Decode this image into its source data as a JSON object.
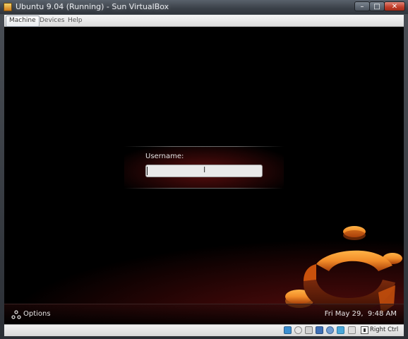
{
  "window": {
    "title": "Ubuntu 9.04 (Running) - Sun VirtualBox",
    "minimize_glyph": "–",
    "maximize_glyph": "□",
    "close_glyph": "✕"
  },
  "menubar": {
    "items": [
      {
        "label": "Machine",
        "active": true
      },
      {
        "label": "Devices",
        "active": false
      },
      {
        "label": "Help",
        "active": false
      }
    ]
  },
  "login": {
    "username_label": "Username:",
    "username_value": "",
    "username_placeholder": ""
  },
  "bottom_bar": {
    "options_label": "Options",
    "clock": "Fri May 29,  9:48 AM"
  },
  "statusbar": {
    "icons": [
      {
        "name": "hard-disk-icon",
        "color": "#3b8fd1"
      },
      {
        "name": "cd-dvd-icon",
        "color": "#c9c9c9"
      },
      {
        "name": "floppy-icon",
        "color": "#c9c9c9"
      },
      {
        "name": "network-icon",
        "color": "#3f6fb5"
      },
      {
        "name": "usb-icon",
        "color": "#6e9ad0"
      },
      {
        "name": "shared-folders-icon",
        "color": "#4aa7d8"
      },
      {
        "name": "display-icon",
        "color": "#dcdcdc"
      },
      {
        "name": "mouse-integration-icon",
        "color": "#bdbdbd"
      },
      {
        "name": "keyboard-capture-icon",
        "color": "#9fb6d1"
      }
    ],
    "host_key_label": "Right Ctrl"
  },
  "colors": {
    "ubuntu_orange": "#f28c28",
    "ubuntu_dark_orange": "#c9510c",
    "close_red": "#c2402c"
  }
}
